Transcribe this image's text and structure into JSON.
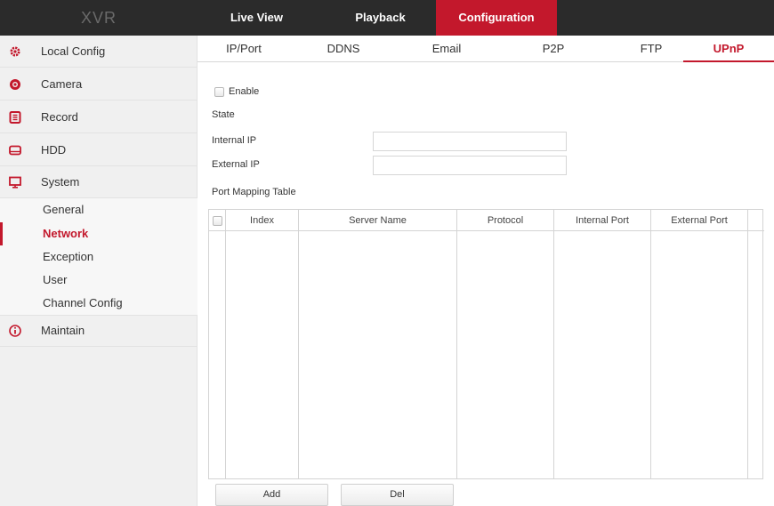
{
  "app": {
    "logo": "XVR"
  },
  "topnav": [
    {
      "label": "Live View"
    },
    {
      "label": "Playback"
    },
    {
      "label": "Configuration",
      "active": true
    }
  ],
  "sidebar": {
    "items": [
      {
        "label": "Local Config",
        "icon": "gear-icon"
      },
      {
        "label": "Camera",
        "icon": "camera-icon"
      },
      {
        "label": "Record",
        "icon": "record-icon"
      },
      {
        "label": "HDD",
        "icon": "hdd-icon"
      },
      {
        "label": "System",
        "icon": "monitor-icon"
      },
      {
        "label": "Maintain",
        "icon": "info-icon"
      }
    ],
    "sub_items": [
      {
        "label": "General"
      },
      {
        "label": "Network",
        "active": true
      },
      {
        "label": "Exception"
      },
      {
        "label": "User"
      },
      {
        "label": "Channel Config"
      }
    ]
  },
  "tabs": [
    {
      "label": "IP/Port"
    },
    {
      "label": "DDNS"
    },
    {
      "label": "Email"
    },
    {
      "label": "P2P"
    },
    {
      "label": "FTP"
    },
    {
      "label": "UPnP",
      "active": true
    }
  ],
  "form": {
    "enable_label": "Enable",
    "enable_checked": false,
    "state_label": "State",
    "internal_ip_label": "Internal IP",
    "internal_ip_value": "",
    "external_ip_label": "External IP",
    "external_ip_value": "",
    "port_mapping_label": "Port Mapping Table"
  },
  "table": {
    "headers": [
      "Index",
      "Server Name",
      "Protocol",
      "Internal Port",
      "External Port"
    ],
    "rows": []
  },
  "buttons": {
    "add": "Add",
    "del": "Del"
  },
  "colors": {
    "accent": "#c3182c",
    "topbar": "#2b2b2b",
    "sidebar": "#f0f0f0"
  }
}
